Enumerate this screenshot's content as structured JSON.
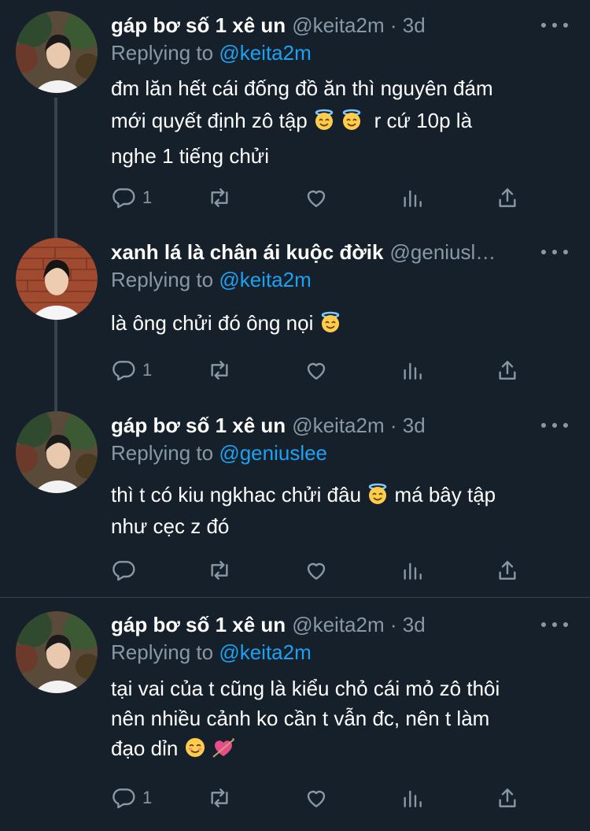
{
  "tweets": [
    {
      "name": "gáp bơ số 1 xê un",
      "handle": "@keita2m · 3d",
      "replying_prefix": "Replying to ",
      "replying_to": "@keita2m",
      "lines": [
        "đm lăn hết cái đống đồ ăn thì nguyên đám",
        "mới quyết định zô tập",
        "r cứ 10p là",
        "nghe 1 tiếng chửi"
      ],
      "reply_count": "1",
      "emojis": [
        "smiling-face-with-halo",
        "smiling-face-with-halo"
      ]
    },
    {
      "name": "xanh lá là chân ái kuộc đờik",
      "handle": "@geniusl…",
      "replying_prefix": "Replying to ",
      "replying_to": "@keita2m",
      "lines": [
        "là ông chửi đó ông nọi"
      ],
      "reply_count": "1",
      "emojis": [
        "smiling-face-with-halo"
      ]
    },
    {
      "name": "gáp bơ số 1 xê un",
      "handle": "@keita2m · 3d",
      "replying_prefix": "Replying to ",
      "replying_to": "@geniuslee",
      "lines": [
        "thì t có kiu ngkhac chửi đâu",
        "má bây tập",
        "như cẹc z đó"
      ],
      "reply_count": "",
      "emojis": [
        "smiling-face-with-halo"
      ]
    },
    {
      "name": "gáp bơ số 1 xê un",
      "handle": "@keita2m · 3d",
      "replying_prefix": "Replying to ",
      "replying_to": "@keita2m",
      "lines": [
        "tại vai của t cũng là kiểu chỏ cái mỏ zô thôi",
        "nên nhiều cảnh ko cần t vẫn đc, nên t làm",
        "đạo dỉn"
      ],
      "reply_count": "1",
      "emojis": [
        "smiling-face",
        "heart-with-arrow"
      ]
    }
  ],
  "colors": {
    "background": "#15202b",
    "secondary_text": "#8899a6",
    "accent": "#1da1f2",
    "divider": "#38444d"
  }
}
